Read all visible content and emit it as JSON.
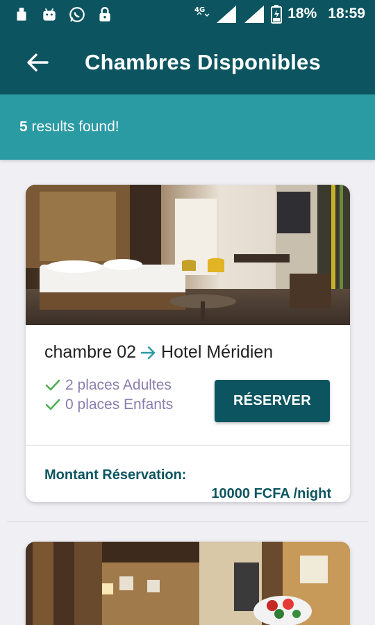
{
  "status_bar": {
    "left_icons": [
      "usb-icon",
      "android-icon",
      "whatsapp-icon",
      "lock-icon"
    ],
    "network": "4G",
    "battery": "18%",
    "time": "18:59"
  },
  "app_bar": {
    "title": "Chambres Disponibles",
    "back_icon": "arrow-left-icon"
  },
  "results": {
    "count": "5",
    "suffix": " results found!"
  },
  "rooms": [
    {
      "name": "chambre 02",
      "hotel": "Hotel Méridien",
      "adults": "2 places Adultes",
      "children": "0 places Enfants",
      "reserve_label": "RÉSERVER",
      "amount_label": "Montant Réservation:",
      "amount_value": "10000 FCFA /night"
    }
  ],
  "colors": {
    "primary": "#0c5560",
    "secondary": "#2a9aa3",
    "feature_text": "#8a7cae",
    "check": "#4caf50",
    "background": "#efeff4"
  }
}
